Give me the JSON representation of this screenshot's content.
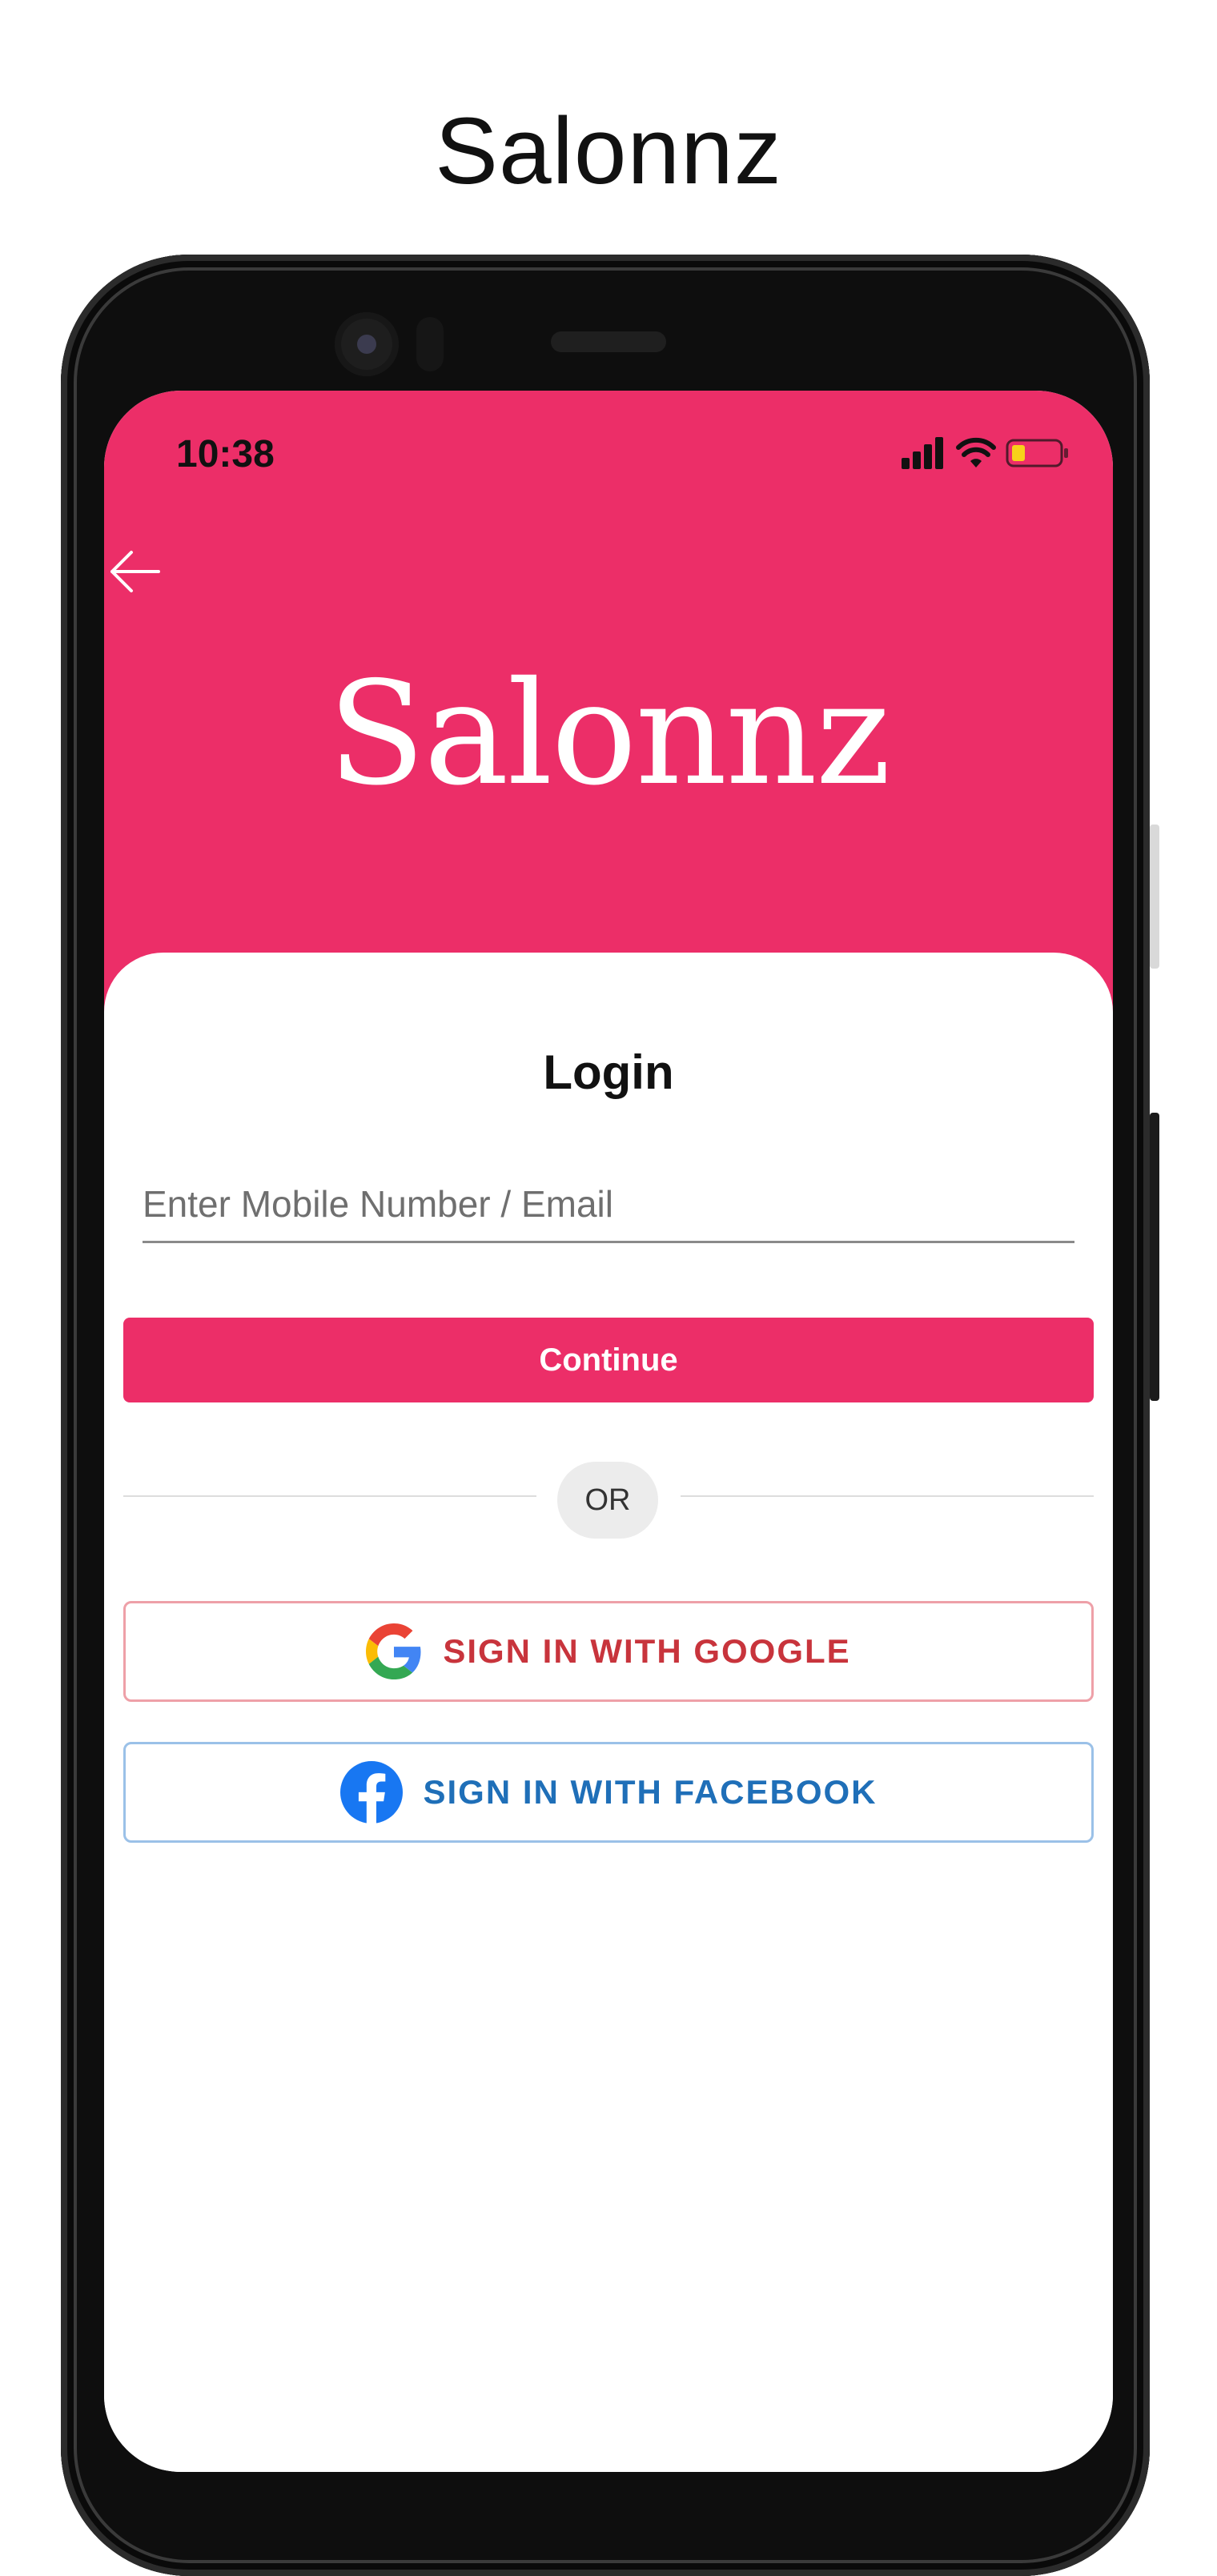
{
  "page": {
    "title": "Salonnz"
  },
  "status_bar": {
    "time": "10:38"
  },
  "header": {
    "logo_text": "Salonnz",
    "bg_color": "#ec2e68",
    "back_icon": "arrow-left-icon"
  },
  "login": {
    "title": "Login",
    "input": {
      "placeholder": "Enter Mobile Number / Email",
      "value": ""
    },
    "continue_label": "Continue",
    "or_label": "OR",
    "google_label": "SIGN IN WITH GOOGLE",
    "facebook_label": "SIGN IN WITH FACEBOOK"
  },
  "colors": {
    "accent": "#ec2e68",
    "google_text": "#c8343c",
    "facebook_text": "#1f6fb8"
  }
}
